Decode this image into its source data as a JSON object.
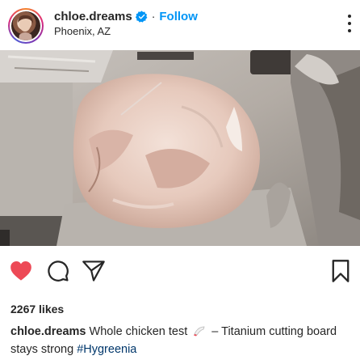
{
  "post": {
    "username": "chloe.dreams",
    "separator": "·",
    "follow_label": "Follow",
    "location": "Phoenix, AZ",
    "likes_text": "2267 likes",
    "caption_before": "Whole chicken test",
    "caption_emoji": "knife-emoji",
    "caption_after": " – Titanium cutting board stays strong ",
    "hashtag": "#Hygreenia",
    "liked": true
  },
  "icons": {
    "verified": "verified-badge-icon",
    "more": "more-options-icon",
    "like": "heart-icon",
    "comment": "comment-icon",
    "share": "share-icon",
    "save": "bookmark-icon"
  },
  "colors": {
    "accent": "#0095f6",
    "like": "#ed4956",
    "hashtag": "#00376b",
    "text": "#262626"
  }
}
